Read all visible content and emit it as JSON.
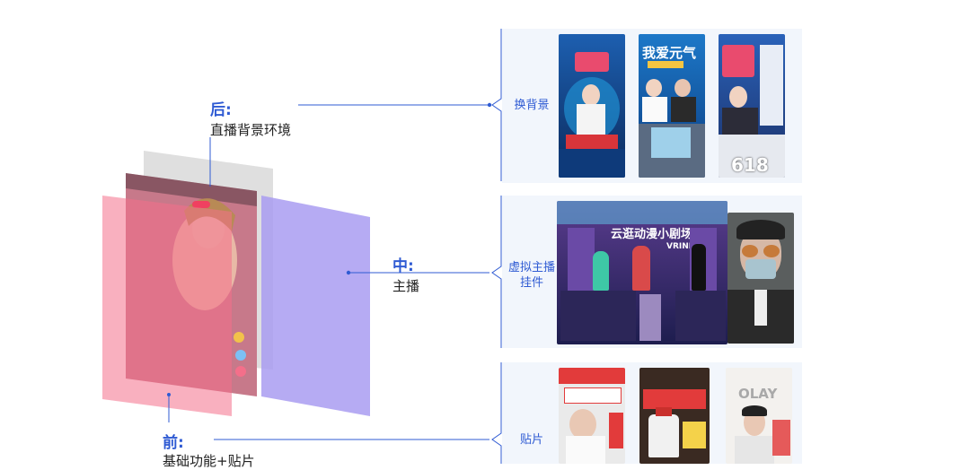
{
  "layers": {
    "back": {
      "head": "后:",
      "sub": "直播背景环境"
    },
    "middle": {
      "head": "中:",
      "sub": "主播"
    },
    "front": {
      "head": "前:",
      "sub": "基础功能+贴片"
    }
  },
  "rows": [
    {
      "label": "换背景",
      "thumbs": [
        "彩色背景直播间",
        "我爱元气 直播",
        "618 直播间"
      ]
    },
    {
      "label": "虚拟主播\n挂件",
      "thumbs": [
        "云逛动漫小剧场",
        "真人主播"
      ]
    },
    {
      "label": "贴片",
      "thumbs": [
        "贴片直播间",
        "产品贴片",
        "OLAY 直播"
      ]
    }
  ],
  "thumb_text": {
    "t2": "我爱元气",
    "t3": "618",
    "t4_title": "云逛动漫小剧场",
    "t4_brand": "VRINDER",
    "t7": "OLAY"
  },
  "colors": {
    "accent": "#2f5bd3",
    "front_layer": "#f46f8a",
    "middle_layer": "#a99cf1",
    "back_layer": "#d9d9d9",
    "panel": "#f2f6fc"
  }
}
